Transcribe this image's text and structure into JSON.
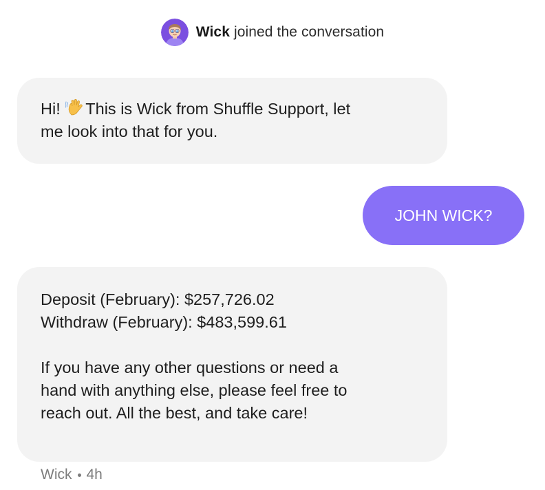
{
  "join_notice": {
    "agent_name": "Wick",
    "text": "joined the conversation"
  },
  "messages": [
    {
      "sender": "agent",
      "lines": [
        {
          "before_emoji": "Hi!",
          "emoji": "waving-hand-icon",
          "after_emoji": "This is Wick from Shuffle Support, let"
        },
        {
          "text": "me look into that for you."
        }
      ]
    },
    {
      "sender": "user",
      "text": "JOHN WICK?"
    },
    {
      "sender": "agent",
      "lines": [
        {
          "text": "Deposit (February): $257,726.02"
        },
        {
          "text": "Withdraw (February): $483,599.61"
        },
        {
          "text": ""
        },
        {
          "text": "If you have any other questions or need a"
        },
        {
          "text": "hand with anything else, please feel free to"
        },
        {
          "text": "reach out. All the best, and take care!"
        }
      ]
    }
  ],
  "meta": {
    "author": "Wick",
    "time": "4h"
  },
  "colors": {
    "user_bubble": "#8870f7",
    "agent_bubble": "#f3f3f3",
    "avatar_bg": "#7b4fe0",
    "meta_text": "#7c7c7c"
  }
}
